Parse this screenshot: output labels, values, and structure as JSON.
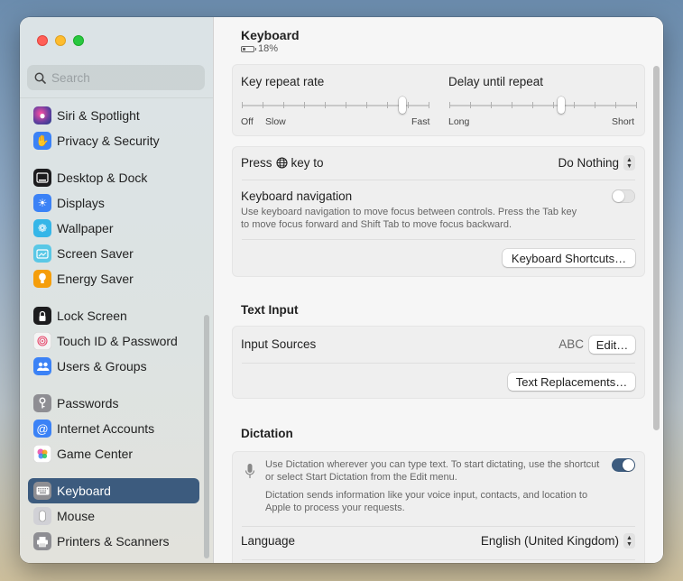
{
  "sidebar": {
    "search_placeholder": "Search",
    "items": [
      {
        "label": "Siri & Spotlight",
        "icon": "siri-icon",
        "color": "#6b3fa0"
      },
      {
        "label": "Privacy & Security",
        "icon": "hand-icon",
        "color": "#3b82f6"
      },
      {
        "label": "Desktop & Dock",
        "icon": "dock-icon",
        "color": "#1c1c1e"
      },
      {
        "label": "Displays",
        "icon": "sun-icon",
        "color": "#3b82f6"
      },
      {
        "label": "Wallpaper",
        "icon": "flower-icon",
        "color": "#35b6e8"
      },
      {
        "label": "Screen Saver",
        "icon": "screensaver-icon",
        "color": "#5ac8e6"
      },
      {
        "label": "Energy Saver",
        "icon": "bulb-icon",
        "color": "#f59e0b"
      },
      {
        "label": "Lock Screen",
        "icon": "lock-icon",
        "color": "#1c1c1e"
      },
      {
        "label": "Touch ID & Password",
        "icon": "fingerprint-icon",
        "color": "#f4f4f4"
      },
      {
        "label": "Users & Groups",
        "icon": "users-icon",
        "color": "#3b82f6"
      },
      {
        "label": "Passwords",
        "icon": "key-icon",
        "color": "#8e8e93"
      },
      {
        "label": "Internet Accounts",
        "icon": "at-icon",
        "color": "#3b82f6"
      },
      {
        "label": "Game Center",
        "icon": "gamecenter-icon",
        "color": "#ffffff"
      },
      {
        "label": "Keyboard",
        "icon": "keyboard-icon",
        "color": "#8e8e93"
      },
      {
        "label": "Mouse",
        "icon": "mouse-icon",
        "color": "#d1d1d6"
      },
      {
        "label": "Printers & Scanners",
        "icon": "printer-icon",
        "color": "#8e8e93"
      }
    ]
  },
  "header": {
    "title": "Keyboard",
    "battery": "18%"
  },
  "repeat": {
    "key_repeat_label": "Key repeat rate",
    "delay_label": "Delay until repeat",
    "off": "Off",
    "slow": "Slow",
    "fast": "Fast",
    "long": "Long",
    "short": "Short",
    "key_repeat_level": 0.87,
    "delay_level": 0.6
  },
  "press_key": {
    "label_pre": "Press",
    "label_post": "key to",
    "value": "Do Nothing"
  },
  "keyboard_nav": {
    "label": "Keyboard navigation",
    "desc_1": "Use keyboard navigation to move focus between controls. Press the Tab key",
    "desc_2": "to move focus forward and Shift Tab to move focus backward.",
    "enabled": false
  },
  "shortcuts_button": "Keyboard Shortcuts…",
  "text_input": {
    "title": "Text Input",
    "input_sources_label": "Input Sources",
    "input_sources_value": "ABC",
    "edit_button": "Edit…",
    "replacements_button": "Text Replacements…"
  },
  "dictation": {
    "title": "Dictation",
    "desc_1": "Use Dictation wherever you can type text. To start dictating, use the shortcut",
    "desc_2": "or select Start Dictation from the Edit menu.",
    "desc_3": "Dictation sends information like your voice input, contacts, and location to",
    "desc_4": "Apple to process your requests.",
    "enabled": true,
    "language_label": "Language",
    "language_value": "English (United Kingdom)"
  },
  "colors": {
    "accent": "#3c5b7e"
  }
}
